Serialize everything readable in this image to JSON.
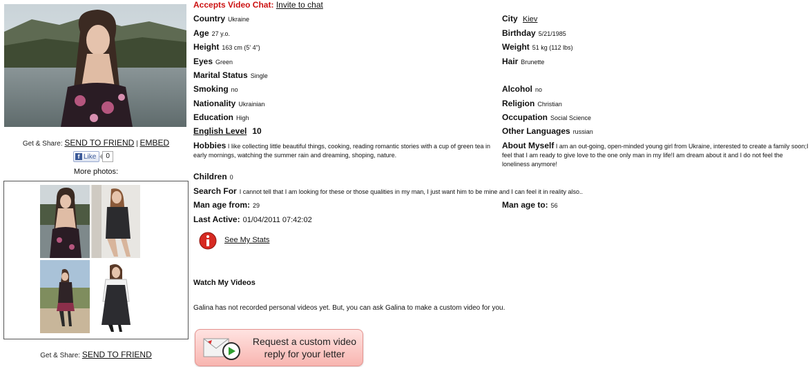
{
  "left": {
    "share_label": "Get & Share:",
    "send_to_friend": "SEND TO FRIEND",
    "separator": "|",
    "embed": "EMBED",
    "fb_like": "Like",
    "fb_count": "0",
    "more_photos": "More photos:",
    "share_label_bottom": "Get & Share:",
    "send_to_friend_bottom": "SEND TO FRIEND"
  },
  "profile": {
    "video_chat_label": "Accepts Video Chat:",
    "invite_to_chat": "Invite to chat",
    "country_label": "Country",
    "country": "Ukraine",
    "city_label": "City",
    "city": "Kiev",
    "age_label": "Age",
    "age": "27 y.o.",
    "birthday_label": "Birthday",
    "birthday": "5/21/1985",
    "height_label": "Height",
    "height": "163 cm (5' 4\")",
    "weight_label": "Weight",
    "weight": "51 kg (112 lbs)",
    "eyes_label": "Eyes",
    "eyes": "Green",
    "hair_label": "Hair",
    "hair": "Brunette",
    "marital_label": "Marital Status",
    "marital": "Single",
    "smoking_label": "Smoking",
    "smoking": "no",
    "alcohol_label": "Alcohol",
    "alcohol": "no",
    "nationality_label": "Nationality",
    "nationality": "Ukrainian",
    "religion_label": "Religion",
    "religion": "Christian",
    "education_label": "Education",
    "education": "High",
    "occupation_label": "Occupation",
    "occupation": "Social Science",
    "english_label": "English Level",
    "english": "10",
    "languages_label": "Other Languages",
    "languages": "russian",
    "hobbies_label": "Hobbies",
    "hobbies": "I like collecting little beautiful things, cooking, reading romantic stories with a cup of green tea in early mornings, watching the summer rain and dreaming, shoping, nature.",
    "about_label": "About Myself",
    "about": "I am an out-going, open-minded young girl from Ukraine, interested to create a family soon;I feel that I am ready to give love to the one only man in my life!I am dream about it and I do not feel the loneliness anymore!",
    "children_label": "Children",
    "children": "0",
    "search_label": "Search For",
    "search": "I cannot tell that I am looking for these or those qualities in my man, I just want him to be mine and I can feel it in reality also..",
    "age_from_label": "Man age from:",
    "age_from": "29",
    "age_to_label": "Man age to:",
    "age_to": "56",
    "last_active_label": "Last Active:",
    "last_active": "01/04/2011 07:42:02",
    "stats_link": "See My Stats"
  },
  "videos": {
    "heading": "Watch My Videos",
    "note": "Galina has not recorded personal videos yet. But, you can ask Galina to make a custom video for you.",
    "cta_line1": "Request a custom video",
    "cta_line2": "reply for your letter"
  },
  "colors": {
    "accent_red": "#cc1111",
    "cta_pink": "#f8b5b0"
  }
}
